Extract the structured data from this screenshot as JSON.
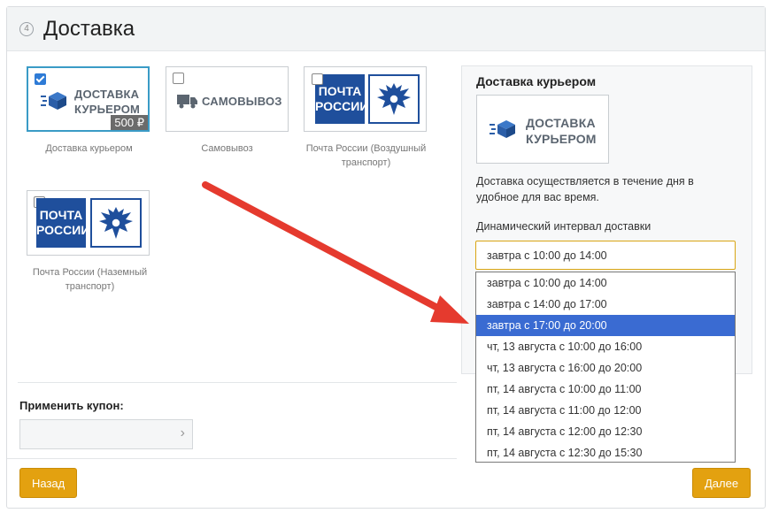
{
  "header": {
    "step": "4",
    "title": "Доставка"
  },
  "tiles": [
    {
      "logo_line1": "ДОСТАВКА",
      "logo_line2": "КУРЬЕРОМ",
      "price": "500 ₽",
      "caption": "Доставка курьером",
      "checked": true
    },
    {
      "logo": "САМОВЫВОЗ",
      "caption": "Самовывоз",
      "checked": false
    },
    {
      "logo_line1": "ПОЧТА",
      "logo_line2": "РОССИИ",
      "caption_line1": "Почта России (Воздушный",
      "caption_line2": "транспорт)",
      "checked": false
    },
    {
      "logo_line1": "ПОЧТА",
      "logo_line2": "РОССИИ",
      "caption_line1": "Почта России (Наземный",
      "caption_line2": "транспорт)",
      "checked": false
    }
  ],
  "side": {
    "title": "Доставка курьером",
    "logo_line1": "ДОСТАВКА",
    "logo_line2": "КУРЬЕРОМ",
    "desc_line1": "Доставка осуществляется в течение дня в",
    "desc_line2": "удобное для вас время.",
    "interval_label": "Динамический интервал доставки",
    "selected_value": "завтра с 10:00 до 14:00"
  },
  "dropdown_options": [
    "завтра с 10:00 до 14:00",
    "завтра с 14:00 до 17:00",
    "завтра с 17:00 до 20:00",
    "чт, 13 августа с 10:00 до 16:00",
    "чт, 13 августа с 16:00 до 20:00",
    "пт, 14 августа с 10:00 до 11:00",
    "пт, 14 августа с 11:00 до 12:00",
    "пт, 14 августа с 12:00 до 12:30",
    "пт, 14 августа с 12:30 до 15:30"
  ],
  "dropdown_highlighted": 2,
  "coupon": {
    "label": "Применить купон:",
    "value": ""
  },
  "buttons": {
    "back": "Назад",
    "next": "Далее"
  },
  "colors": {
    "accent": "#e3a110",
    "highlight": "#3a6bd2",
    "arrow": "#e53a2e",
    "pochta_blue": "#1f4f9c"
  }
}
